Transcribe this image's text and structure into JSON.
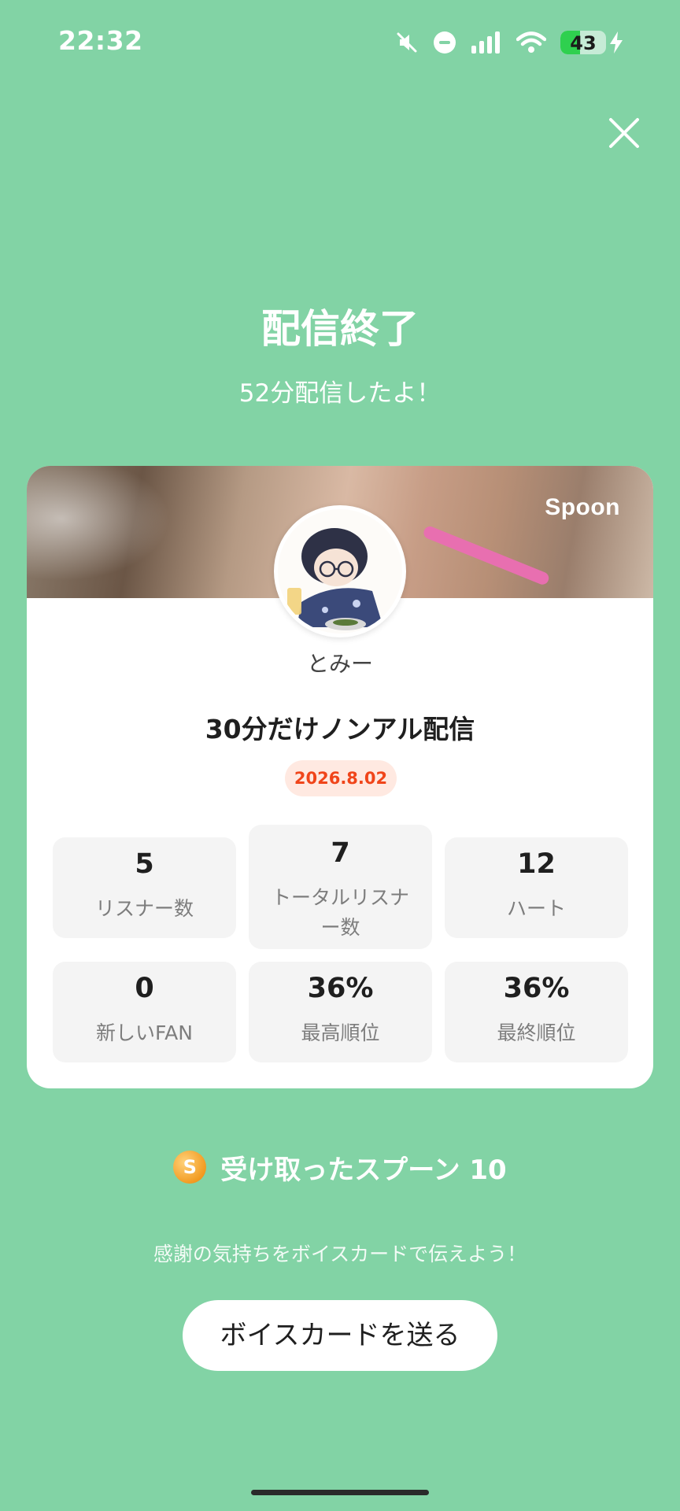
{
  "status_bar": {
    "time": "22:32",
    "battery_percent": "43",
    "battery_level": 0.43,
    "icons": [
      "mute-icon",
      "do-not-disturb-icon",
      "signal-icon",
      "wifi-icon",
      "battery-icon",
      "charging-bolt-icon"
    ]
  },
  "header": {
    "title": "配信終了",
    "subtitle": "52分配信したよ！",
    "close_icon": "close-icon"
  },
  "card": {
    "brand": "Spoon",
    "host_name": "とみー",
    "live_title": "30分だけノンアル配信",
    "date": "2026.8.02",
    "stats": [
      {
        "value": "5",
        "label": "リスナー数"
      },
      {
        "value": "7",
        "label": "トータルリスナー数"
      },
      {
        "value": "12",
        "label": "ハート"
      },
      {
        "value": "0",
        "label": "新しいFAN"
      },
      {
        "value": "36%",
        "label": "最高順位"
      },
      {
        "value": "36%",
        "label": "最終順位"
      }
    ]
  },
  "spoons": {
    "coin_letter": "S",
    "label": "受け取ったスプーン 10"
  },
  "footer": {
    "thanks_text": "感謝の気持ちをボイスカードで伝えよう！",
    "send_button": "ボイスカードを送る"
  },
  "colors": {
    "background": "#82d3a5",
    "date_badge_bg": "#ffe9e1",
    "date_badge_text": "#f0451a",
    "coin": "#f29b22"
  }
}
